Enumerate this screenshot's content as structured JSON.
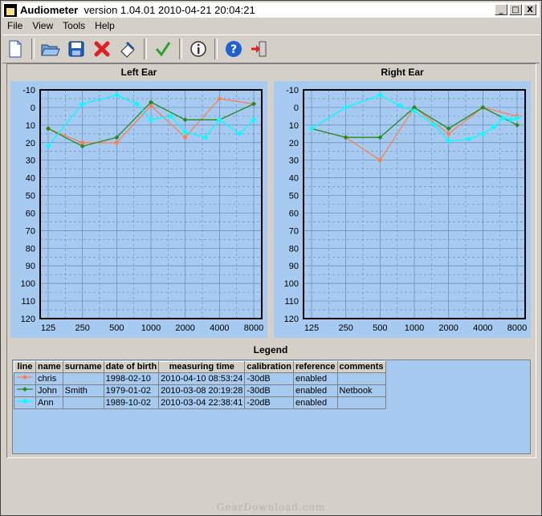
{
  "window": {
    "title_app": "Audiometer",
    "title_rest": "version 1.04.01 2010-04-21 20:04:21",
    "minimize": "_",
    "maximize": "□",
    "close": "X"
  },
  "menu": {
    "items": [
      "File",
      "View",
      "Tools",
      "Help"
    ]
  },
  "toolbar": {
    "buttons": [
      "new-icon",
      "open-icon",
      "save-icon",
      "delete-icon",
      "clear-icon",
      "check-icon",
      "info-icon",
      "help-icon",
      "exit-icon"
    ]
  },
  "colors": {
    "chris": "#ff7f50",
    "john": "#228b22",
    "ann": "#00ffff",
    "plot_bg": "#a6caf0"
  },
  "legend": {
    "title": "Legend",
    "headers": [
      "line",
      "name",
      "surname",
      "date of birth",
      "measuring time",
      "calibration",
      "reference",
      "comments"
    ],
    "rows": [
      [
        "chris",
        "",
        "1998-02-10",
        "2010-04-10 08:53:24",
        "-30dB",
        "enabled",
        ""
      ],
      [
        "John",
        "Smith",
        "1979-01-02",
        "2010-03-08 20:19:28",
        "-30dB",
        "enabled",
        "Netbook"
      ],
      [
        "Ann",
        "",
        "1989-10-02",
        "2010-03-04 22:38:41",
        "-20dB",
        "enabled",
        ""
      ]
    ]
  },
  "chart_data": [
    {
      "type": "line",
      "title": "Left Ear",
      "x_ticks": [
        "125",
        "250",
        "500",
        "1000",
        "2000",
        "4000",
        "8000"
      ],
      "y_ticks": [
        "-10",
        "0",
        "10",
        "20",
        "30",
        "40",
        "50",
        "60",
        "70",
        "80",
        "90",
        "100",
        "110",
        "120"
      ],
      "ylim": [
        -10,
        120
      ],
      "y_inverted": true,
      "grid": true,
      "series": [
        {
          "name": "chris",
          "x": [
            125,
            250,
            500,
            1000,
            2000,
            4000,
            8000
          ],
          "y": [
            12,
            20,
            20,
            -1,
            17,
            -5,
            -2
          ]
        },
        {
          "name": "John",
          "x": [
            125,
            250,
            500,
            1000,
            2000,
            4000,
            8000
          ],
          "y": [
            12,
            22,
            17,
            -3,
            7,
            7,
            -2
          ]
        },
        {
          "name": "Ann",
          "x": [
            125,
            250,
            500,
            750,
            1000,
            1500,
            2000,
            3000,
            4000,
            6000,
            8000
          ],
          "y": [
            22,
            -2,
            -7,
            -2,
            7,
            5,
            14,
            17,
            7,
            15,
            7
          ]
        }
      ]
    },
    {
      "type": "line",
      "title": "Right Ear",
      "x_ticks": [
        "125",
        "250",
        "500",
        "1000",
        "2000",
        "4000",
        "8000"
      ],
      "y_ticks": [
        "-10",
        "0",
        "10",
        "20",
        "30",
        "40",
        "50",
        "60",
        "70",
        "80",
        "90",
        "100",
        "110",
        "120"
      ],
      "ylim": [
        -10,
        120
      ],
      "y_inverted": true,
      "grid": true,
      "series": [
        {
          "name": "chris",
          "x": [
            125,
            250,
            500,
            1000,
            2000,
            4000,
            8000
          ],
          "y": [
            12,
            17,
            30,
            0,
            15,
            0,
            5
          ]
        },
        {
          "name": "John",
          "x": [
            125,
            250,
            500,
            1000,
            2000,
            4000,
            8000
          ],
          "y": [
            12,
            17,
            17,
            0,
            12,
            0,
            10
          ]
        },
        {
          "name": "Ann",
          "x": [
            125,
            250,
            500,
            750,
            1000,
            1500,
            2000,
            3000,
            4000,
            5000,
            6000,
            7000,
            8000
          ],
          "y": [
            12,
            0,
            -7,
            -1,
            2,
            10,
            19,
            18,
            15,
            11,
            6,
            7,
            6
          ]
        }
      ]
    }
  ],
  "watermark": "GearDownload.com"
}
